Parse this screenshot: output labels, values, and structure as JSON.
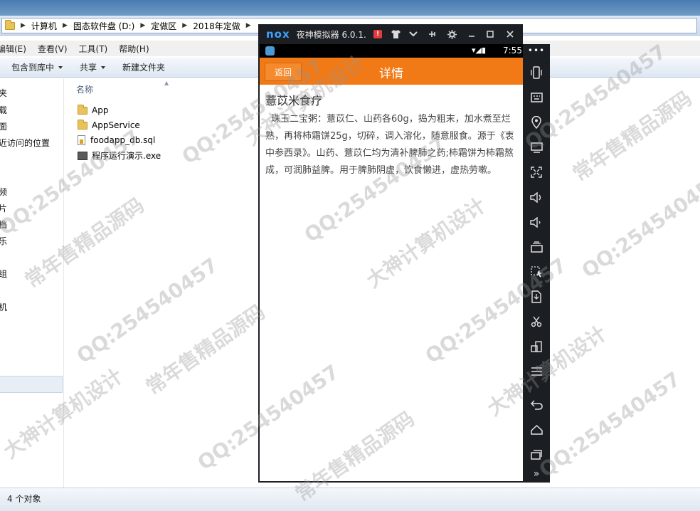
{
  "explorer": {
    "breadcrumb": [
      "计算机",
      "固态软件盘 (D:)",
      "定做区",
      "2018年定做"
    ],
    "menu": [
      "编辑(E)",
      "查看(V)",
      "工具(T)",
      "帮助(H)"
    ],
    "toolbar": {
      "include_label": "包含到库中",
      "share_label": "共享",
      "new_folder_label": "新建文件夹"
    },
    "nav_items": [
      "夹",
      "载",
      "面",
      "近访问的位置",
      "频",
      "片",
      "档",
      "乐",
      "组",
      "机"
    ],
    "column_header": "名称",
    "files": [
      {
        "name": "App",
        "icon": "folder-icon"
      },
      {
        "name": "AppService",
        "icon": "folder-icon"
      },
      {
        "name": "foodapp_db.sql",
        "icon": "sql-file-icon"
      },
      {
        "name": "程序运行演示.exe",
        "icon": "exe-file-icon"
      }
    ],
    "status": "4 个对象"
  },
  "emulator": {
    "logo": "nox",
    "title": "夜神模拟器 6.0.1.",
    "android_time": "7:55",
    "app": {
      "back_label": "返回",
      "title": "详情",
      "detail_title": "薏苡米食疗",
      "detail_body": "珠玉二宝粥：薏苡仁、山药各60g，捣为粗末，加水煮至烂熟，再将柿霜饼25g，切碎，调入溶化，随意服食。源于《衷中参西录》。山药、薏苡仁均为清补脾肺之药;柿霜饼为柿霜熬成，可润肺益脾。用于脾肺阴虚，饮食懒进，虚热劳嗽。"
    },
    "side_more": "•••",
    "side_bottom": "»"
  },
  "watermarks": [
    "QQ:254540457",
    "常年售精品源码",
    "大神计算机设计"
  ]
}
